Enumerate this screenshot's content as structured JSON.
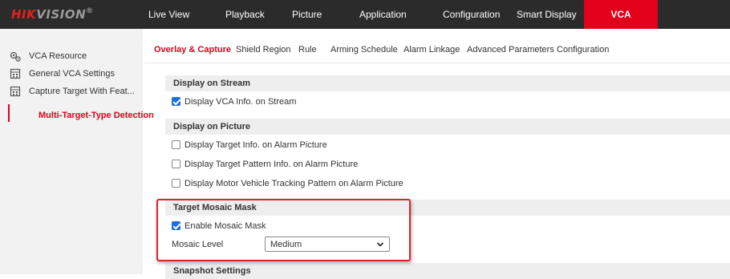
{
  "brand": {
    "logo_part1": "HIK",
    "logo_part2": "VISION",
    "logo_reg": "®"
  },
  "nav": {
    "items": [
      "Live View",
      "Playback",
      "Picture",
      "Application",
      "Configuration",
      "Smart Display",
      "VCA"
    ],
    "active": "VCA"
  },
  "sidebar": {
    "items": [
      {
        "label": "VCA Resource",
        "icon": "camera-settings-icon"
      },
      {
        "label": "General VCA Settings",
        "icon": "grid-settings-icon"
      },
      {
        "label": "Capture Target With Feat...",
        "icon": "grid-settings-icon"
      },
      {
        "label": "Multi-Target-Type Detection",
        "icon": ""
      }
    ],
    "active": "Multi-Target-Type Detection"
  },
  "tabs": {
    "items": [
      "Overlay & Capture",
      "Shield Region",
      "Rule",
      "Arming Schedule",
      "Alarm Linkage",
      "Advanced Parameters Configuration"
    ],
    "active": "Overlay & Capture"
  },
  "sections": {
    "display_on_stream": {
      "title": "Display on Stream",
      "options": [
        {
          "label": "Display VCA Info. on Stream",
          "checked": true
        }
      ]
    },
    "display_on_picture": {
      "title": "Display on Picture",
      "options": [
        {
          "label": "Display Target Info. on Alarm Picture",
          "checked": false
        },
        {
          "label": "Display Target Pattern Info. on Alarm Picture",
          "checked": false
        },
        {
          "label": "Display Motor Vehicle Tracking Pattern on Alarm Picture",
          "checked": false
        }
      ]
    },
    "target_mosaic_mask": {
      "title": "Target Mosaic Mask",
      "options": [
        {
          "label": "Enable Mosaic Mask",
          "checked": true
        }
      ],
      "mosaic_level_label": "Mosaic Level",
      "mosaic_level_value": "Medium"
    },
    "snapshot_settings": {
      "title": "Snapshot Settings"
    }
  },
  "colors": {
    "brand_red": "#e2001a",
    "topbar": "#2b2b2b",
    "checkbox_blue": "#1e6fd9",
    "highlight_border": "#d9242a"
  }
}
